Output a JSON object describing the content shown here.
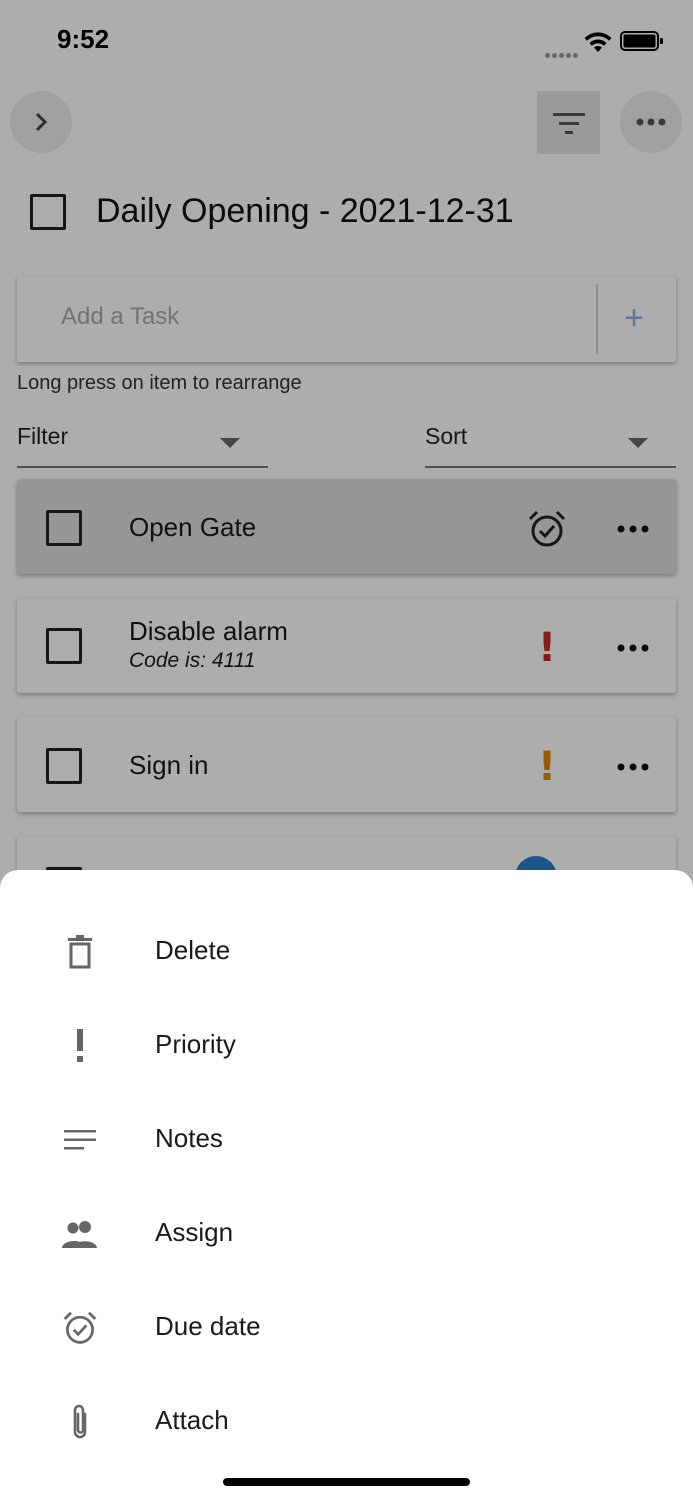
{
  "status_bar": {
    "time": "9:52"
  },
  "header": {
    "list_title": "Daily Opening - 2021-12-31"
  },
  "add_task": {
    "placeholder": "Add a Task",
    "add_symbol": "+"
  },
  "hint": "Long press on item to rearrange",
  "filter": {
    "label": "Filter"
  },
  "sort": {
    "label": "Sort"
  },
  "tasks": [
    {
      "title": "Open Gate",
      "icon": "alarm-check-icon"
    },
    {
      "title": "Disable alarm",
      "subtitle": "Code is: 4111",
      "priority": "!",
      "priority_color": "#c62828"
    },
    {
      "title": "Sign in",
      "priority": "!",
      "priority_color": "#e08a00"
    }
  ],
  "peek_task": {
    "dot_color": "#2a7fc6"
  },
  "sheet": {
    "items": [
      {
        "label": "Delete",
        "icon": "trash-icon"
      },
      {
        "label": "Priority",
        "icon": "exclamation-icon"
      },
      {
        "label": "Notes",
        "icon": "notes-icon"
      },
      {
        "label": "Assign",
        "icon": "people-icon"
      },
      {
        "label": "Due date",
        "icon": "alarm-check-icon"
      },
      {
        "label": "Attach",
        "icon": "paperclip-icon"
      }
    ]
  }
}
